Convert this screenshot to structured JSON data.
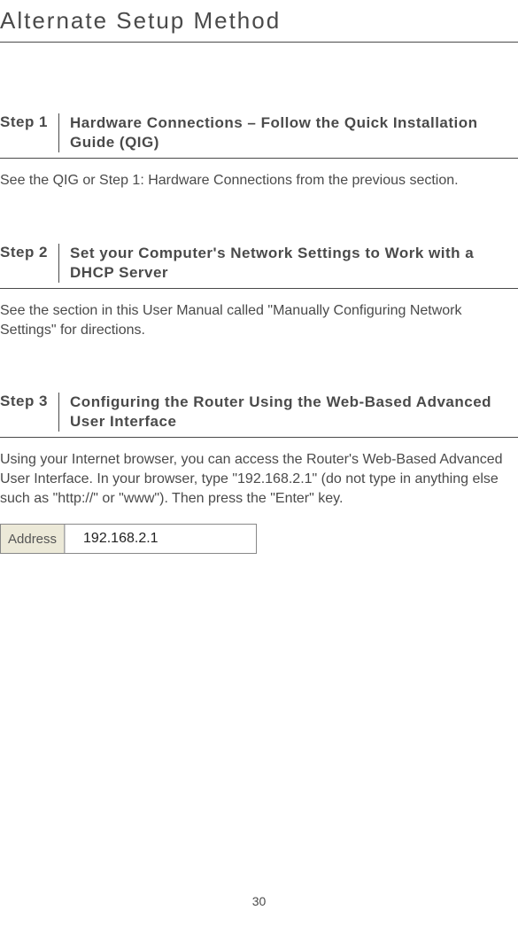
{
  "page": {
    "title": "Alternate Setup Method",
    "number": "30"
  },
  "steps": [
    {
      "label": "Step 1",
      "title": "Hardware Connections – Follow the Quick Installation Guide (QIG)",
      "body": "See the QIG or Step 1: Hardware Connections from the previous section."
    },
    {
      "label": "Step 2",
      "title": "Set your Computer's Network Settings to Work with a DHCP Server",
      "body": "See the section in this User Manual called \"Manually Configuring Network Settings\" for directions."
    },
    {
      "label": "Step 3",
      "title": "Configuring the Router Using the Web-Based Advanced User Interface",
      "body": "Using your Internet browser, you can access the Router's Web-Based Advanced User Interface. In your browser, type \"192.168.2.1\" (do not type in anything else such as \"http://\" or \"www\"). Then press the \"Enter\" key."
    }
  ],
  "addressBar": {
    "label": "Address",
    "value": "192.168.2.1"
  }
}
